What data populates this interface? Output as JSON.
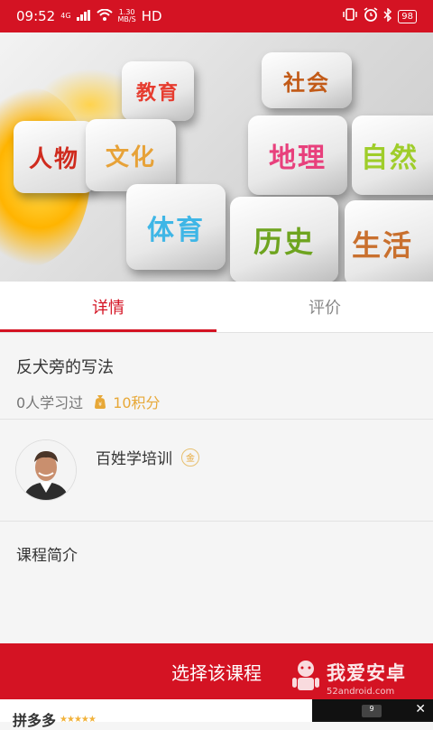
{
  "status_bar": {
    "time": "09:52",
    "network_type": "4G",
    "speed_value": "1.30",
    "speed_unit": "MB/S",
    "hd_label": "HD",
    "battery": "98",
    "icons": [
      "signal-icon",
      "wifi-icon",
      "vibrate-icon",
      "alarm-icon",
      "bluetooth-icon",
      "battery-icon"
    ]
  },
  "hero": {
    "tiles": [
      "教育",
      "人物",
      "文化",
      "社会",
      "地理",
      "自然",
      "体育",
      "历史",
      "生活"
    ]
  },
  "tabs": [
    {
      "label": "详情",
      "active": true
    },
    {
      "label": "评价",
      "active": false
    }
  ],
  "course": {
    "title": "反犬旁的写法",
    "learners": "0人学习过",
    "points": "10积分"
  },
  "teacher": {
    "name": "百姓学培训",
    "badge": "金"
  },
  "intro": {
    "label": "课程简介"
  },
  "cta": {
    "label": "选择该课程"
  },
  "watermark": {
    "text": "我爱安卓",
    "url": "52android.com"
  },
  "bottom_bar": {
    "app_name": "拼多多",
    "stars": "★★★★★",
    "ad_badge": "9"
  },
  "colors": {
    "brand_red": "#d41323",
    "gold": "#e7a838"
  }
}
